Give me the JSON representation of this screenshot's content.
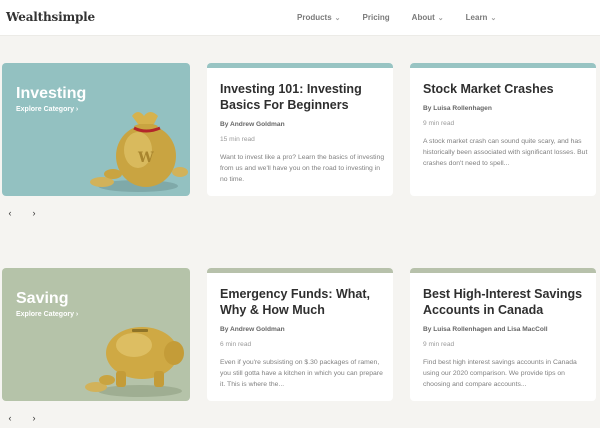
{
  "header": {
    "logo": "Wealthsimple",
    "nav": [
      {
        "label": "Products",
        "dropdown": true
      },
      {
        "label": "Pricing",
        "dropdown": false
      },
      {
        "label": "About",
        "dropdown": true
      },
      {
        "label": "Learn",
        "dropdown": true
      }
    ]
  },
  "sections": [
    {
      "category": "Investing",
      "explore": "Explore Category  ›",
      "accent": "#93c1c1",
      "cards": [
        {
          "title": "Investing 101: Investing Basics For Beginners",
          "author": "By Andrew Goldman",
          "read": "15 min read",
          "excerpt": "Want to invest like a pro? Learn the basics of investing from us and we'll have you on the road to investing in no time."
        },
        {
          "title": "Stock Market Crashes",
          "author": "By Luisa Rollenhagen",
          "read": "9 min read",
          "excerpt": "A stock market crash can sound quite scary, and has historically been associated with significant losses. But crashes don't need to spell..."
        }
      ]
    },
    {
      "category": "Saving",
      "explore": "Explore Category  ›",
      "accent": "#b5c3a9",
      "cards": [
        {
          "title": "Emergency Funds: What, Why & How Much",
          "author": "By Andrew Goldman",
          "read": "6 min read",
          "excerpt": "Even if you're subsisting on $.30 packages of ramen, you still gotta have a kitchen in which you can prepare it. This is where the..."
        },
        {
          "title": "Best High-Interest Savings Accounts in Canada",
          "author": "By Luisa Rollenhagen and Lisa MacColl",
          "read": "9 min read",
          "excerpt": "Find best high interest savings accounts in Canada using our 2020 comparison. We provide tips on choosing and compare accounts..."
        }
      ]
    }
  ],
  "carousel": {
    "prev": "‹",
    "next": "›"
  }
}
